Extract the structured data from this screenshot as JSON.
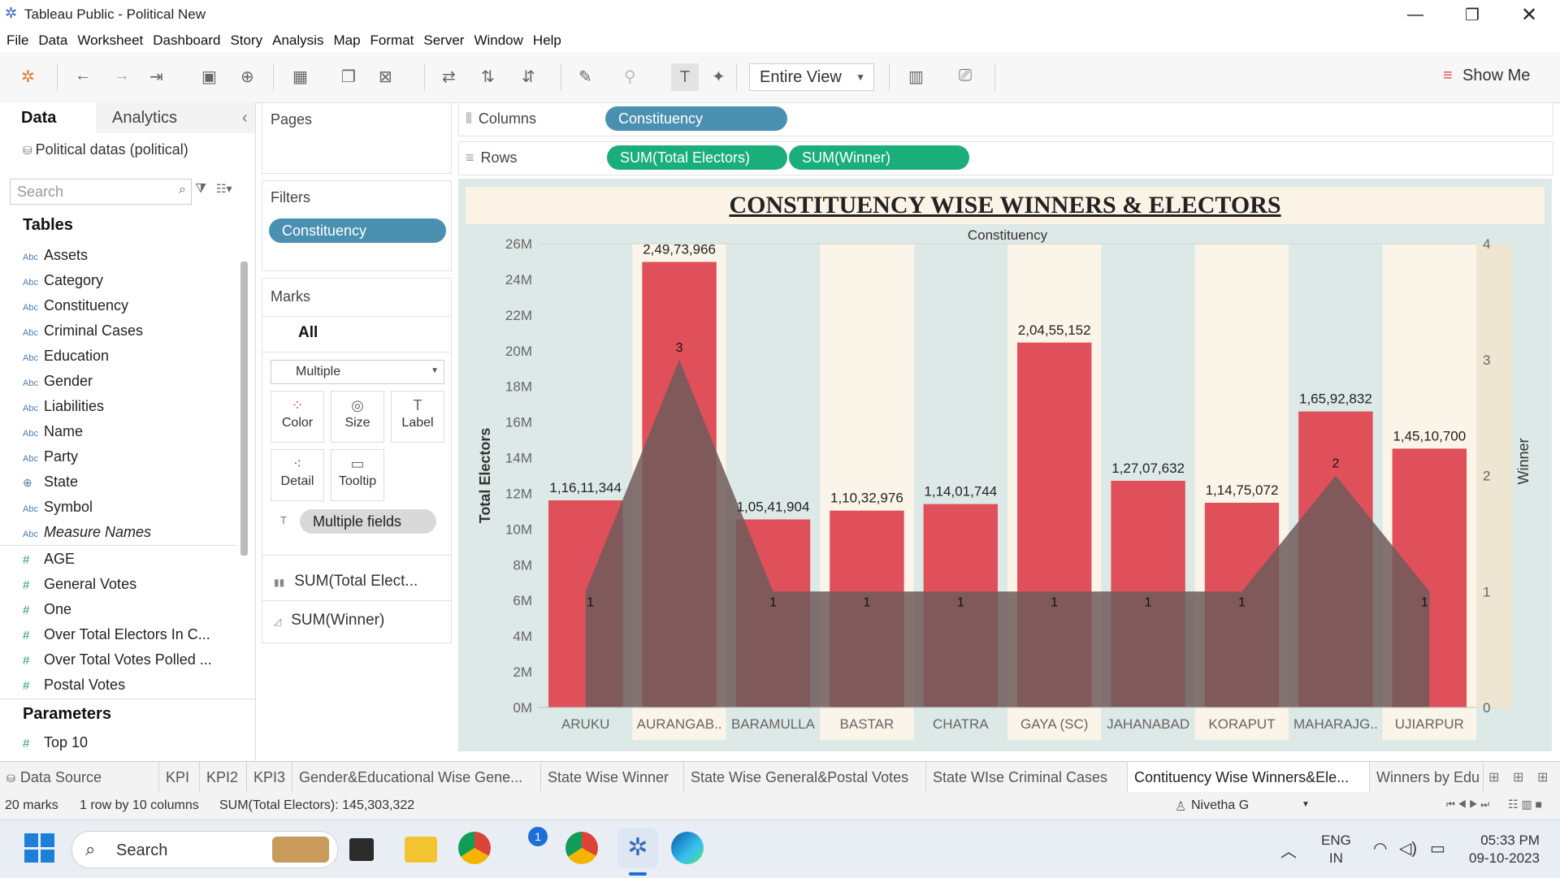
{
  "window": {
    "title": "Tableau Public - Political New"
  },
  "menu": [
    "File",
    "Data",
    "Worksheet",
    "Dashboard",
    "Story",
    "Analysis",
    "Map",
    "Format",
    "Server",
    "Window",
    "Help"
  ],
  "toolbar": {
    "view_mode": "Entire View",
    "show_me": "Show Me"
  },
  "data_pane": {
    "tab_data": "Data",
    "tab_analytics": "Analytics",
    "datasource": "Political datas (political)",
    "search_placeholder": "Search",
    "tables_header": "Tables",
    "dimensions": [
      {
        "type": "Abc",
        "name": "Assets"
      },
      {
        "type": "Abc",
        "name": "Category"
      },
      {
        "type": "Abc",
        "name": "Constituency"
      },
      {
        "type": "Abc",
        "name": "Criminal Cases"
      },
      {
        "type": "Abc",
        "name": "Education"
      },
      {
        "type": "Abc",
        "name": "Gender"
      },
      {
        "type": "Abc",
        "name": "Liabilities"
      },
      {
        "type": "Abc",
        "name": "Name"
      },
      {
        "type": "Abc",
        "name": "Party"
      },
      {
        "type": "globe",
        "name": "State"
      },
      {
        "type": "Abc",
        "name": "Symbol"
      },
      {
        "type": "Abc",
        "name": "Measure Names"
      }
    ],
    "measures": [
      {
        "type": "#",
        "name": "AGE"
      },
      {
        "type": "#",
        "name": "General Votes"
      },
      {
        "type": "#",
        "name": "One"
      },
      {
        "type": "#",
        "name": "Over Total Electors  In C..."
      },
      {
        "type": "#",
        "name": "Over Total Votes Polled ..."
      },
      {
        "type": "#",
        "name": "Postal Votes"
      }
    ],
    "parameters_header": "Parameters",
    "parameters": [
      {
        "type": "#",
        "name": "Top 10"
      }
    ]
  },
  "cards": {
    "pages": "Pages",
    "filters": "Filters",
    "filter_pill": "Constituency",
    "marks": "Marks",
    "marks_all": "All",
    "mark_type": "Multiple",
    "buttons": [
      "Color",
      "Size",
      "Label",
      "Detail",
      "Tooltip"
    ],
    "multiple_fields": "Multiple fields",
    "measure1": "SUM(Total Elect...",
    "measure2": "SUM(Winner)"
  },
  "shelves": {
    "columns_label": "Columns",
    "columns_pill": "Constituency",
    "rows_label": "Rows",
    "rows_pill1": "SUM(Total Electors)",
    "rows_pill2": "SUM(Winner)"
  },
  "chart_data": {
    "type": "bar",
    "title": "CONSTITUENCY WISE WINNERS & ELECTORS",
    "column_header": "Constituency",
    "ylabel": "Total Electors",
    "ylabel2": "Winner",
    "ylim": [
      0,
      26000000
    ],
    "y_ticks": [
      "0M",
      "2M",
      "4M",
      "6M",
      "8M",
      "10M",
      "12M",
      "14M",
      "16M",
      "18M",
      "20M",
      "22M",
      "24M",
      "26M"
    ],
    "y2lim": [
      0,
      4
    ],
    "y2_ticks": [
      "0",
      "1",
      "2",
      "3",
      "4"
    ],
    "categories": [
      "ARUKU",
      "AURANGAB..",
      "BARAMULLA",
      "BASTAR",
      "CHATRA",
      "GAYA (SC)",
      "JAHANABAD",
      "KORAPUT",
      "MAHARAJG..",
      "UJIARPUR"
    ],
    "series": [
      {
        "name": "SUM(Total Electors)",
        "values": [
          11611344,
          24973966,
          10541904,
          11032976,
          11401744,
          20455152,
          12707632,
          11475072,
          16592832,
          14510700
        ],
        "labels": [
          "1,16,11,344",
          "2,49,73,966",
          "1,05,41,904",
          "1,10,32,976",
          "1,14,01,744",
          "2,04,55,152",
          "1,27,07,632",
          "1,14,75,072",
          "1,65,92,832",
          "1,45,10,700"
        ]
      },
      {
        "name": "SUM(Winner)",
        "values": [
          1,
          3,
          1,
          1,
          1,
          1,
          1,
          1,
          2,
          1
        ]
      }
    ],
    "colors": {
      "bar": "#e0505a",
      "area": "#6e5a5a",
      "band_light": "#fbf4e8",
      "band_dark": "#dde9e6"
    }
  },
  "sheet_tabs": [
    "Data Source",
    "KPI",
    "KPI2",
    "KPI3",
    "Gender&Educational Wise Gene...",
    "State Wise Winner",
    "State Wise General&Postal Votes",
    "State WIse Criminal Cases",
    "Contituency Wise Winners&Ele...",
    "Winners by Edu"
  ],
  "status": {
    "marks": "20 marks",
    "dims": "1 row by 10 columns",
    "sum": "SUM(Total Electors): 145,303,322",
    "user": "Nivetha G"
  },
  "taskbar": {
    "search": "Search",
    "lang1": "ENG",
    "lang2": "IN",
    "time": "05:33 PM",
    "date": "09-10-2023",
    "badge": "1"
  }
}
